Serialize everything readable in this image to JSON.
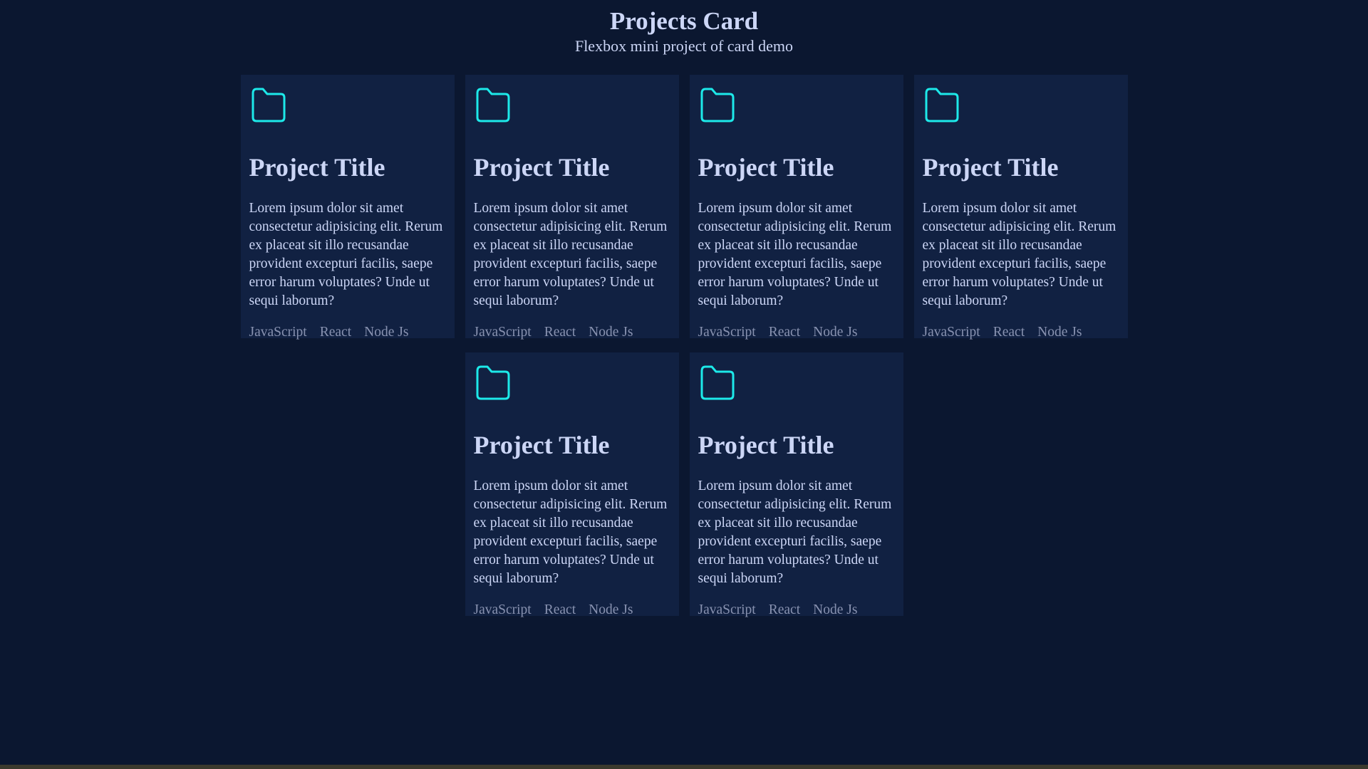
{
  "header": {
    "title": "Projects Card",
    "subtitle": "Flexbox mini project of card demo"
  },
  "colors": {
    "background": "#0b1730",
    "card": "#112142",
    "accent": "#1de9e9",
    "text": "#ccd6f6",
    "muted": "#8892b0"
  },
  "cards": [
    {
      "icon": "folder-icon",
      "title": "Project Title",
      "description": "Lorem ipsum dolor sit amet consectetur adipisicing elit. Rerum ex placeat sit illo recusandae provident excepturi facilis, saepe error harum voluptates? Unde ut sequi laborum?",
      "tags": [
        "JavaScript",
        "React",
        "Node Js"
      ]
    },
    {
      "icon": "folder-icon",
      "title": "Project Title",
      "description": "Lorem ipsum dolor sit amet consectetur adipisicing elit. Rerum ex placeat sit illo recusandae provident excepturi facilis, saepe error harum voluptates? Unde ut sequi laborum?",
      "tags": [
        "JavaScript",
        "React",
        "Node Js"
      ]
    },
    {
      "icon": "folder-icon",
      "title": "Project Title",
      "description": "Lorem ipsum dolor sit amet consectetur adipisicing elit. Rerum ex placeat sit illo recusandae provident excepturi facilis, saepe error harum voluptates? Unde ut sequi laborum?",
      "tags": [
        "JavaScript",
        "React",
        "Node Js"
      ]
    },
    {
      "icon": "folder-icon",
      "title": "Project Title",
      "description": "Lorem ipsum dolor sit amet consectetur adipisicing elit. Rerum ex placeat sit illo recusandae provident excepturi facilis, saepe error harum voluptates? Unde ut sequi laborum?",
      "tags": [
        "JavaScript",
        "React",
        "Node Js"
      ]
    },
    {
      "icon": "folder-icon",
      "title": "Project Title",
      "description": "Lorem ipsum dolor sit amet consectetur adipisicing elit. Rerum ex placeat sit illo recusandae provident excepturi facilis, saepe error harum voluptates? Unde ut sequi laborum?",
      "tags": [
        "JavaScript",
        "React",
        "Node Js"
      ]
    },
    {
      "icon": "folder-icon",
      "title": "Project Title",
      "description": "Lorem ipsum dolor sit amet consectetur adipisicing elit. Rerum ex placeat sit illo recusandae provident excepturi facilis, saepe error harum voluptates? Unde ut sequi laborum?",
      "tags": [
        "JavaScript",
        "React",
        "Node Js"
      ]
    }
  ]
}
